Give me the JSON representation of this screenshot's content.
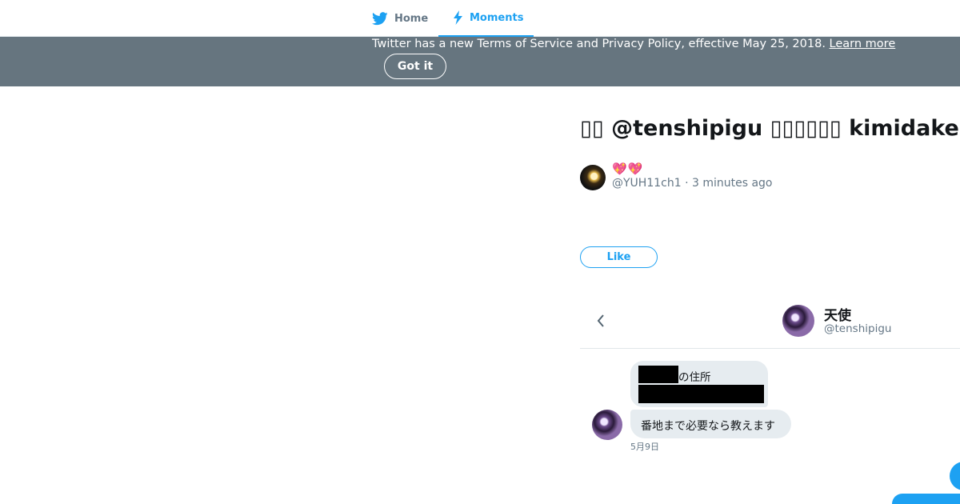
{
  "nav": {
    "home_label": "Home",
    "moments_label": "Moments",
    "brand_color": "#1da1f2"
  },
  "banner": {
    "text": "Twitter has a new Terms of Service and Privacy Policy, effective May 25, 2018.",
    "link_label": "Learn more",
    "button_label": "Got it",
    "bg_color": "#66757f"
  },
  "tweet": {
    "title": "▯▯ @tenshipigu ▯▯▯▯▯▯ kimidake",
    "author_display": "💖💖",
    "handle": "@YUH11ch1",
    "time": "3 minutes ago",
    "like_label": "Like"
  },
  "media": {
    "dm_name": "天使",
    "dm_handle": "@tenshipigu",
    "msg1": "の住所",
    "msg2": "番地まで必要なら教えます",
    "date": "5月9日"
  }
}
